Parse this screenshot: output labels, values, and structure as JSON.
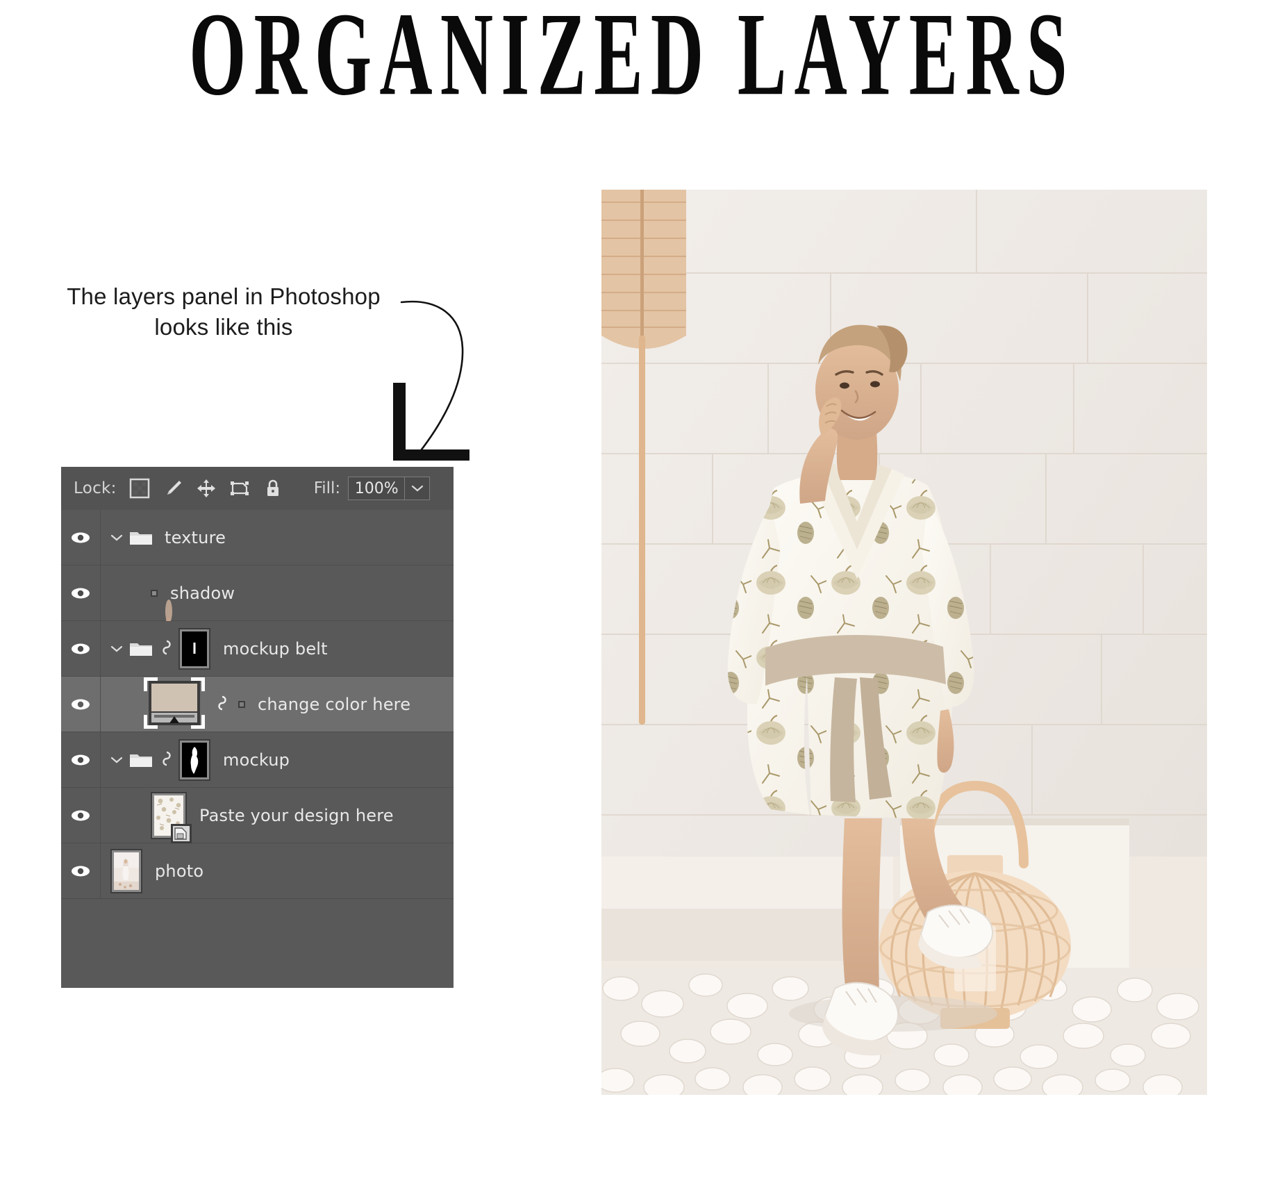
{
  "title": "ORGANIZED LAYERS",
  "caption": {
    "line1": "The layers panel in Photoshop",
    "line2": "looks like this"
  },
  "arrow": {
    "icon_name": "curved-down-arrow"
  },
  "panel": {
    "lock": {
      "label": "Lock:",
      "icons": [
        "lock-transparent-pixels-icon",
        "lock-image-pixels-brush-icon",
        "lock-position-move-icon",
        "lock-nesting-artboard-icon",
        "lock-all-padlock-icon"
      ]
    },
    "fill": {
      "label": "Fill:",
      "value": "100%",
      "caret_icon": "chevron-down-icon"
    },
    "layers": [
      {
        "name": "texture",
        "type": "group",
        "visible": true,
        "expanded": true,
        "selected": false,
        "has_thumb": false,
        "linked": false,
        "mask": null,
        "indent": 0
      },
      {
        "name": "shadow",
        "type": "pixel",
        "visible": true,
        "expanded": false,
        "selected": false,
        "has_thumb": true,
        "thumb_kind": "transparent-shadow",
        "linked": false,
        "mask": null,
        "indent": 1
      },
      {
        "name": "mockup belt",
        "type": "group",
        "visible": true,
        "expanded": true,
        "selected": false,
        "has_thumb": false,
        "linked": true,
        "mask": "black",
        "indent": 0
      },
      {
        "name": "change color here",
        "type": "adjustment",
        "visible": true,
        "expanded": false,
        "selected": true,
        "has_thumb": true,
        "thumb_kind": "solid-color-swatch",
        "swatch_color": "#cfc2b3",
        "linked": true,
        "mask": "white",
        "indent": 1
      },
      {
        "name": "mockup",
        "type": "group",
        "visible": true,
        "expanded": true,
        "selected": false,
        "has_thumb": false,
        "linked": true,
        "mask": "black-figure",
        "indent": 0
      },
      {
        "name": "Paste your design here",
        "type": "smart-object",
        "visible": true,
        "expanded": false,
        "selected": false,
        "has_thumb": true,
        "thumb_kind": "pattern-smart-object",
        "linked": false,
        "mask": null,
        "indent": 1
      },
      {
        "name": "photo",
        "type": "pixel",
        "visible": true,
        "expanded": false,
        "selected": false,
        "has_thumb": true,
        "thumb_kind": "photo",
        "linked": false,
        "mask": null,
        "indent": 0
      }
    ],
    "visibility_icon": "eye-icon",
    "expand_icon": "chevron-down-icon",
    "group_icon": "folder-icon",
    "link_icon": "link-chain-icon"
  },
  "photo": {
    "alt_name": "model-wearing-pumpkin-pattern-kimono-robe",
    "scene": "white brick wall studio with bamboo lantern and white pebbles"
  },
  "colors": {
    "panel_bg": "#535353",
    "row_bg": "#595959",
    "row_selected_bg": "#6e6e6e",
    "row_divider": "#4d4d4d",
    "text_light": "#e9e9e9",
    "swatch": "#cfc2b3",
    "title_black": "#0a0a0a"
  }
}
